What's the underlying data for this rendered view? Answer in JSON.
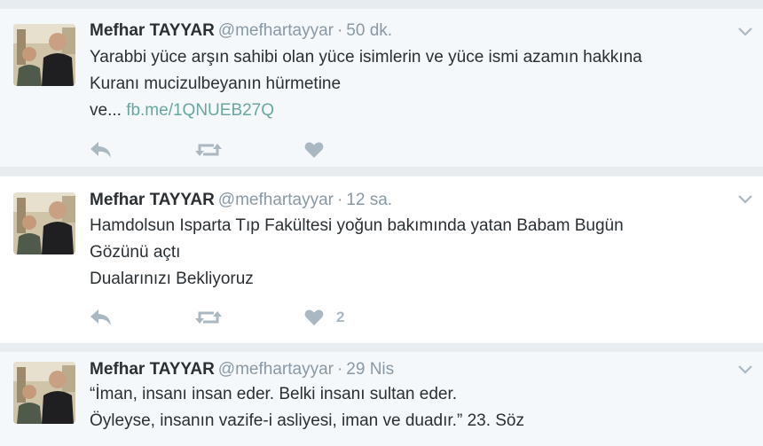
{
  "colors": {
    "page_background": "#e6ecf0",
    "tweet_read_background": "#f5f8fa",
    "tweet_background": "#ffffff",
    "name": "#292f33",
    "meta": "#8899a6",
    "link": "#68a6a0",
    "action_icon": "#aab8c2"
  },
  "icons": {
    "reply": "reply-icon",
    "retweet": "retweet-icon",
    "like": "heart-icon",
    "more": "chevron-down-icon"
  },
  "tweets": [
    {
      "fullname": "Mefhar TAYYAR",
      "screen_name": "@mefhartayyar",
      "separator": "·",
      "time": "50 dk.",
      "lines": [
        "Yarabbi yüce arşın sahibi olan yüce isimlerin ve yüce ismi azamın hakkına",
        "Kuranı mucizulbeyanın hürmetine"
      ],
      "trail_text": "ve...",
      "link": "fb.me/1QNUEB27Q",
      "like_count": ""
    },
    {
      "fullname": "Mefhar TAYYAR",
      "screen_name": "@mefhartayyar",
      "separator": "·",
      "time": "12 sa.",
      "lines": [
        "Hamdolsun Isparta Tıp Fakültesi yoğun bakımında yatan Babam Bugün",
        "Gözünü açtı",
        "Dualarınızı Bekliyoruz"
      ],
      "like_count": "2"
    },
    {
      "fullname": "Mefhar TAYYAR",
      "screen_name": "@mefhartayyar",
      "separator": "·",
      "time": "29 Nis",
      "lines": [
        "“İman, insanı insan eder. Belki insanı sultan eder.",
        "Öyleyse, insanın vazife-i asliyesi, iman ve duadır.”  23. Söz"
      ]
    }
  ]
}
